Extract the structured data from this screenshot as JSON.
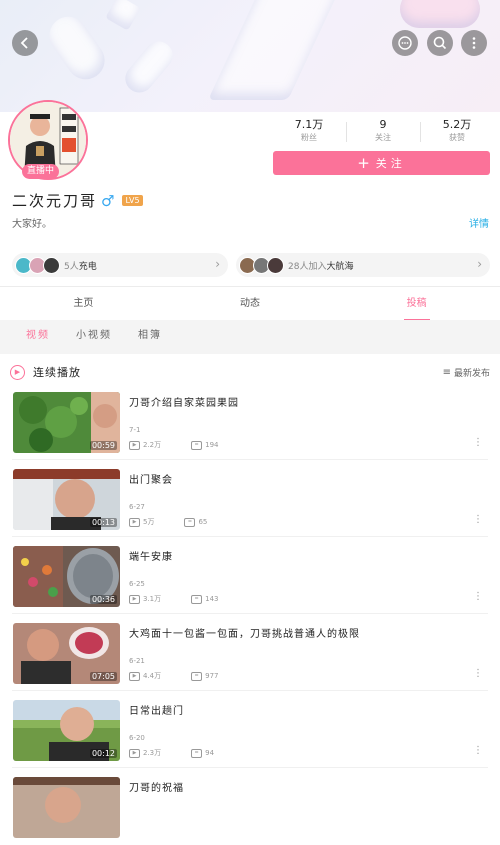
{
  "header": {
    "back": "back",
    "actions": [
      "chat",
      "search",
      "more"
    ]
  },
  "profile": {
    "live_badge": "直播中",
    "stats": [
      {
        "value": "7.1万",
        "label": "粉丝"
      },
      {
        "value": "9",
        "label": "关注"
      },
      {
        "value": "5.2万",
        "label": "获赞"
      }
    ],
    "follow_label": "关注",
    "name": "二次元刀哥",
    "gender": "♂",
    "level": "LV5",
    "bio": "大家好。",
    "detail_link": "详情"
  },
  "groups": [
    {
      "text_plain": "5人",
      "text_emph": "充电"
    },
    {
      "text_plain": "28人加入",
      "text_emph": "大航海"
    }
  ],
  "tabs": [
    {
      "label": "主页"
    },
    {
      "label": "动态"
    },
    {
      "label": "投稿"
    }
  ],
  "subtabs": [
    {
      "label": "视频"
    },
    {
      "label": "小视频"
    },
    {
      "label": "相簿"
    }
  ],
  "playall_label": "连续播放",
  "sort_label": "最新发布",
  "videos": [
    {
      "title": "刀哥介绍自家菜园果园",
      "date": "7-1",
      "views": "2.2万",
      "comments": "194",
      "duration": "00:59"
    },
    {
      "title": "出门聚会",
      "date": "6-27",
      "views": "5万",
      "comments": "65",
      "duration": "00:13"
    },
    {
      "title": "端午安康",
      "date": "6-25",
      "views": "3.1万",
      "comments": "143",
      "duration": "00:36"
    },
    {
      "title": "大鸡面十一包酱一包面，刀哥挑战普通人的极限",
      "date": "6-21",
      "views": "4.4万",
      "comments": "977",
      "duration": "07:05"
    },
    {
      "title": "日常出趟门",
      "date": "6-20",
      "views": "2.3万",
      "comments": "94",
      "duration": "00:12"
    },
    {
      "title": "刀哥的祝福",
      "date": "",
      "views": "",
      "comments": "",
      "duration": ""
    }
  ],
  "colors": {
    "accent": "#fb7299",
    "link": "#23ade5",
    "gender": "#38a8f0",
    "level": "#f0a44b"
  }
}
